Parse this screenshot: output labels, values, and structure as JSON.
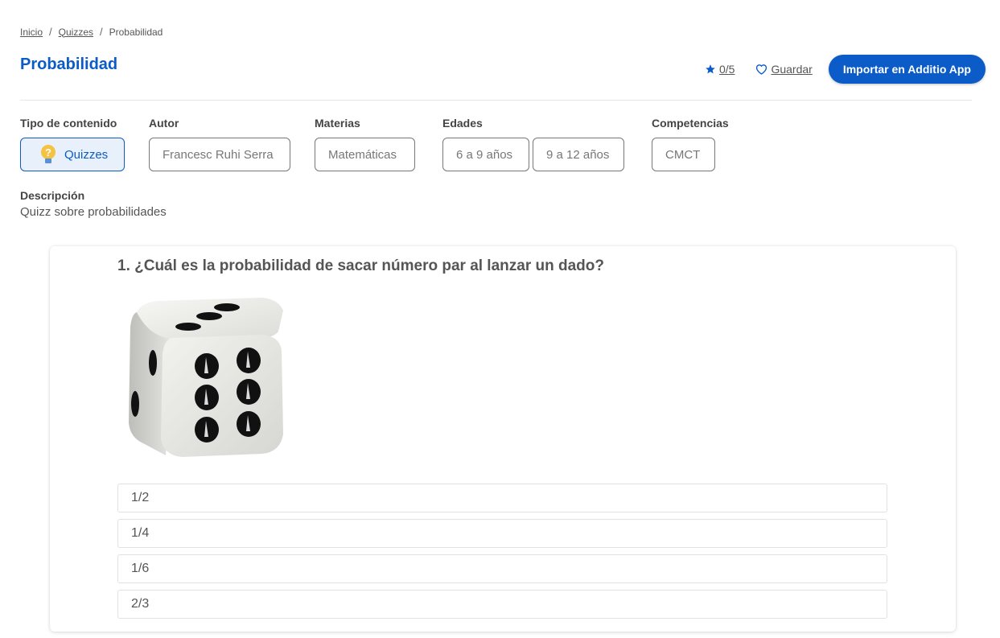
{
  "breadcrumb": {
    "items": [
      "Inicio",
      "Quizzes",
      "Probabilidad"
    ]
  },
  "page": {
    "title": "Probabilidad"
  },
  "header": {
    "rating": "0/5",
    "save_label": "Guardar",
    "import_label": "Importar en Additio App"
  },
  "meta": {
    "content_type": {
      "label": "Tipo de contenido",
      "value": "Quizzes",
      "icon": "lightbulb-icon"
    },
    "author": {
      "label": "Autor",
      "value": "Francesc Ruhi Serra"
    },
    "subjects": {
      "label": "Materias",
      "values": [
        "Matemáticas"
      ]
    },
    "ages": {
      "label": "Edades",
      "values": [
        "6 a 9 años",
        "9 a 12 años"
      ]
    },
    "competencies": {
      "label": "Competencias",
      "values": [
        "CMCT"
      ]
    }
  },
  "description": {
    "label": "Descripción",
    "text": "Quizz sobre probabilidades"
  },
  "quiz": {
    "question": "1. ¿Cuál es la probabilidad de sacar número par al lanzar un dado?",
    "image": "dice-image",
    "answers": [
      "1/2",
      "1/4",
      "1/6",
      "2/3"
    ]
  },
  "colors": {
    "accent": "#0b5cc8",
    "chip_active_bg": "#e8f0fb",
    "text": "#444444"
  }
}
